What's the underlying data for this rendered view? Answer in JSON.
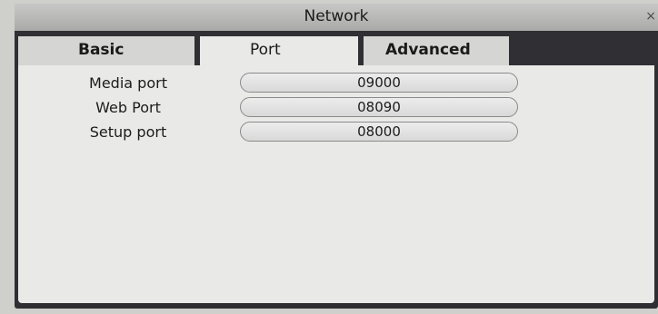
{
  "window": {
    "title": "Network",
    "close_icon": "close-icon"
  },
  "tabs": [
    {
      "label": "Basic",
      "active": false
    },
    {
      "label": "Port",
      "active": true
    },
    {
      "label": "Advanced",
      "active": false
    }
  ],
  "ports": [
    {
      "label": "Media port",
      "value": "09000"
    },
    {
      "label": "Web Port",
      "value": "08090"
    },
    {
      "label": "Setup port",
      "value": "08000"
    }
  ]
}
